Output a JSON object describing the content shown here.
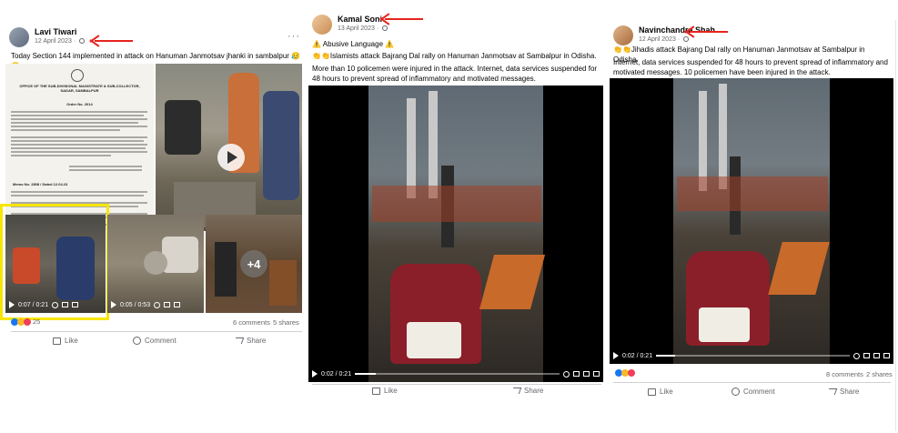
{
  "posts": [
    {
      "author": "Lavi Tiwari",
      "date": "12 April 2023",
      "text": "Today Section 144 implemented in attack on Hanuman Janmotsav jhanki in sambalpur 😥😥",
      "videos": [
        {
          "time": "0:07 / 0:21",
          "progress": 0.33
        },
        {
          "time": "0:05 / 0:53",
          "progress": 0.1
        }
      ],
      "more_count": "+4",
      "reaction_count": "25",
      "comments": "6 comments",
      "shares": "5 shares",
      "actions": {
        "like": "Like",
        "comment": "Comment",
        "share": "Share"
      },
      "doc": {
        "header": "OFFICE OF THE SUB-DIVISIONAL MAGISTRATE & SUB-COLLECTOR, SADAR, SAMBALPUR",
        "order_no": "Order No. 2014",
        "memo": "Memo No. 2808 / Dated 12.04.23"
      }
    },
    {
      "author": "Kamal Soni",
      "date": "13 April 2023",
      "line1": "⚠️ Abusive Language ⚠️",
      "line2": "👏👏Islamists attack Bajrang Dal rally on Hanuman Janmotsav at Sambalpur in Odisha.",
      "line3": "More than 10 policemen were injured in the attack. Internet, data services suspended for 48 hours to prevent spread of inflammatory and motivated messages.",
      "video": {
        "time": "0:02 / 0:21",
        "progress": 0.1
      },
      "actions": {
        "like": "Like",
        "share": "Share"
      }
    },
    {
      "author": "Navinchandra Shah",
      "date": "12 April 2023",
      "line1": "👏👏Jihadis attack Bajrang Dal rally on Hanuman Janmotsav at Sambalpur in Odisha.",
      "line2": "Internet, data services suspended for 48 hours to prevent spread of inflammatory and motivated messages. 10 policemen have been injured in the attack.",
      "video": {
        "time": "0:02 / 0:21",
        "progress": 0.1
      },
      "comments": "8 comments",
      "shares": "2 shares",
      "actions": {
        "like": "Like",
        "comment": "Comment",
        "share": "Share"
      }
    }
  ],
  "colors": {
    "annotation_arrow": "#e8231e",
    "highlight_box": "#f7e600",
    "like_blue": "#1877f2",
    "love_red": "#f33e58",
    "haha_yellow": "#f7b928"
  }
}
